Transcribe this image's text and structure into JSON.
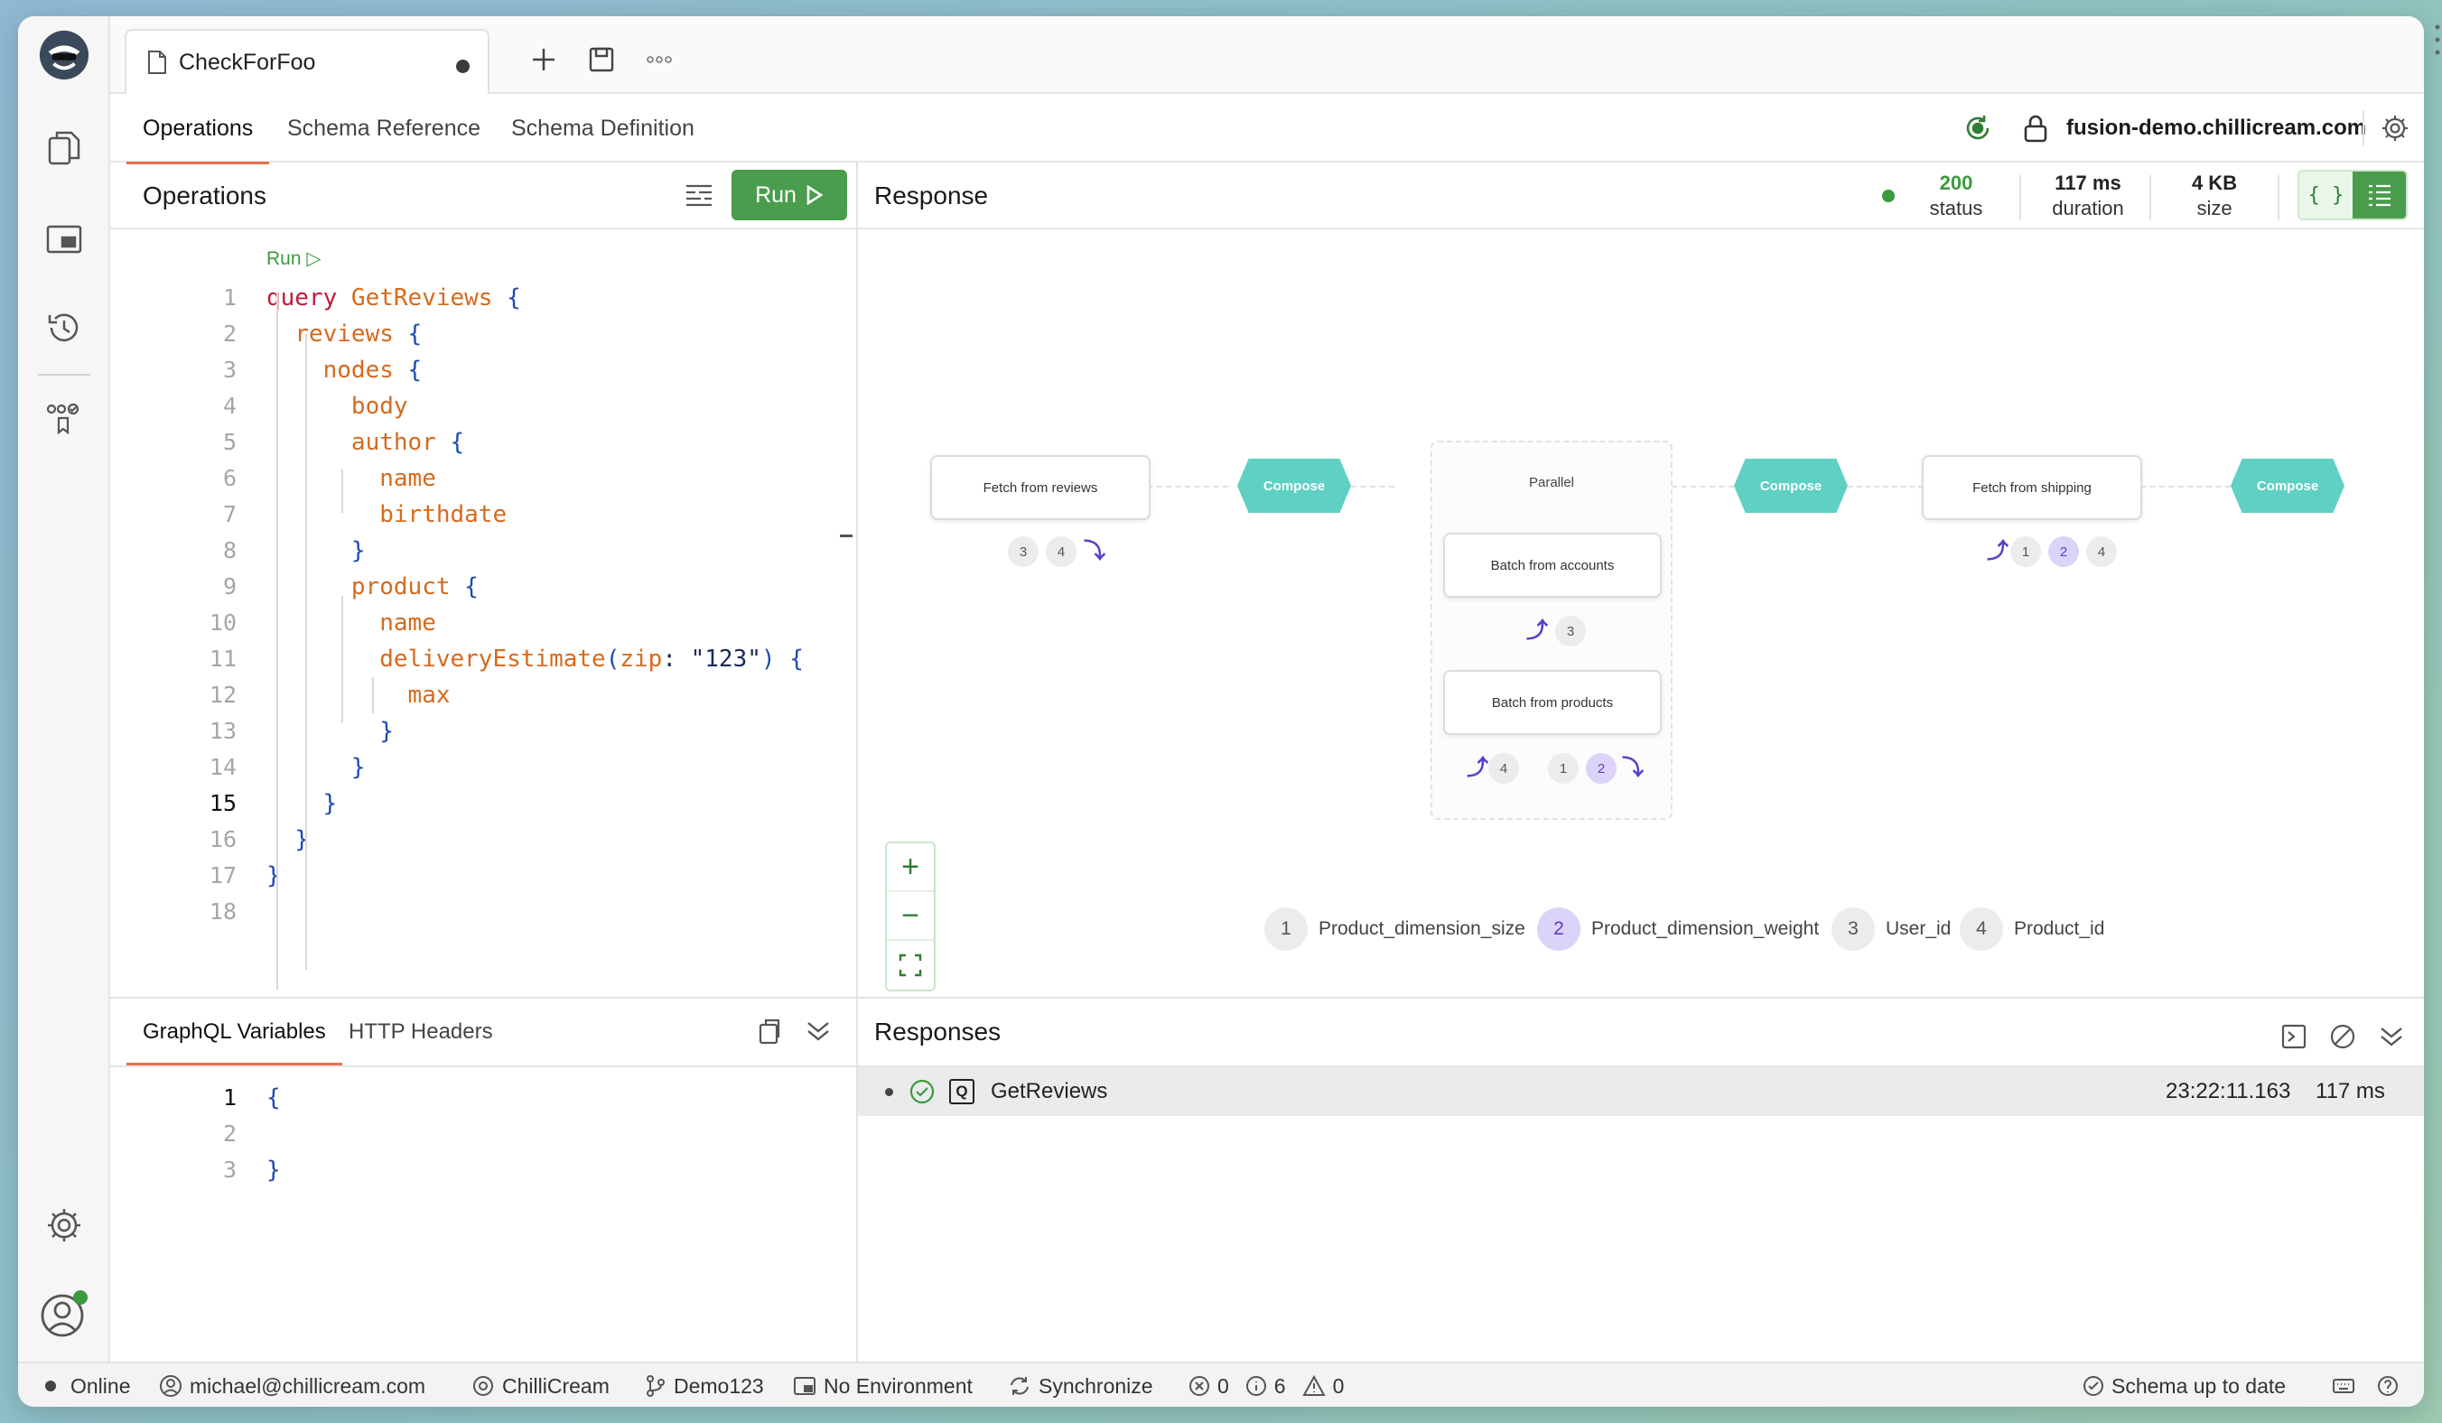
{
  "app": {
    "doc_tab_title": "CheckForFoo",
    "subtabs": [
      "Operations",
      "Schema Reference",
      "Schema Definition"
    ],
    "host": "fusion-demo.chillicream.com"
  },
  "operations": {
    "title": "Operations",
    "run_label": "Run",
    "codelens": "Run ▷",
    "lines": [
      {
        "n": "1",
        "tokens": [
          [
            "k-red",
            "query "
          ],
          [
            "k-orange",
            "GetReviews "
          ],
          [
            "k-blue",
            "{"
          ]
        ]
      },
      {
        "n": "2",
        "tokens": [
          [
            "",
            "  "
          ],
          [
            "k-orange",
            "reviews "
          ],
          [
            "k-blue",
            "{"
          ]
        ]
      },
      {
        "n": "3",
        "tokens": [
          [
            "",
            "    "
          ],
          [
            "k-orange",
            "nodes "
          ],
          [
            "k-blue",
            "{"
          ]
        ]
      },
      {
        "n": "4",
        "tokens": [
          [
            "",
            "      "
          ],
          [
            "k-orange",
            "body"
          ]
        ]
      },
      {
        "n": "5",
        "tokens": [
          [
            "",
            "      "
          ],
          [
            "k-orange",
            "author "
          ],
          [
            "k-blue",
            "{"
          ]
        ]
      },
      {
        "n": "6",
        "tokens": [
          [
            "",
            "        "
          ],
          [
            "k-orange",
            "name"
          ]
        ]
      },
      {
        "n": "7",
        "tokens": [
          [
            "",
            "        "
          ],
          [
            "k-orange",
            "birthdate"
          ]
        ]
      },
      {
        "n": "8",
        "tokens": [
          [
            "",
            "      "
          ],
          [
            "k-blue",
            "}"
          ]
        ]
      },
      {
        "n": "9",
        "tokens": [
          [
            "",
            "      "
          ],
          [
            "k-orange",
            "product "
          ],
          [
            "k-blue",
            "{"
          ]
        ]
      },
      {
        "n": "10",
        "tokens": [
          [
            "",
            "        "
          ],
          [
            "k-orange",
            "name"
          ]
        ]
      },
      {
        "n": "11",
        "tokens": [
          [
            "",
            "        "
          ],
          [
            "k-orange",
            "deliveryEstimate"
          ],
          [
            "k-blue",
            "("
          ],
          [
            "k-orange",
            "zip"
          ],
          [
            "k-dark",
            ": "
          ],
          [
            "k-dark",
            "\"123\""
          ],
          [
            "k-blue",
            ") {"
          ]
        ]
      },
      {
        "n": "12",
        "tokens": [
          [
            "",
            "          "
          ],
          [
            "k-orange",
            "max"
          ]
        ]
      },
      {
        "n": "13",
        "tokens": [
          [
            "",
            "        "
          ],
          [
            "k-blue",
            "}"
          ]
        ]
      },
      {
        "n": "14",
        "tokens": [
          [
            "",
            "      "
          ],
          [
            "k-blue",
            "}"
          ]
        ]
      },
      {
        "n": "15",
        "tokens": [
          [
            "",
            "    "
          ],
          [
            "k-blue",
            "}"
          ]
        ]
      },
      {
        "n": "16",
        "tokens": [
          [
            "",
            "  "
          ],
          [
            "k-blue",
            "}"
          ]
        ]
      },
      {
        "n": "17",
        "tokens": [
          [
            "k-blue",
            "}"
          ]
        ]
      },
      {
        "n": "18",
        "tokens": []
      }
    ],
    "current_line": "15"
  },
  "response": {
    "title": "Response",
    "status_value": "200",
    "status_label": "status",
    "duration_value": "117 ms",
    "duration_label": "duration",
    "size_value": "4 KB",
    "size_label": "size",
    "status_color": "#3a9a3d"
  },
  "plan": {
    "fetch_reviews": "Fetch from reviews",
    "compose1": "Compose",
    "parallel": "Parallel",
    "batch_accounts": "Batch from accounts",
    "batch_products": "Batch from products",
    "compose2": "Compose",
    "fetch_shipping": "Fetch from shipping",
    "compose3": "Compose",
    "badges": {
      "reviews": [
        "3",
        "4"
      ],
      "accounts": [
        "3"
      ],
      "products_a": [
        "4"
      ],
      "products_b": [
        "1",
        "2"
      ],
      "shipping": [
        "1",
        "2",
        "4"
      ]
    },
    "legend": [
      {
        "n": "1",
        "label": "Product_dimension_size"
      },
      {
        "n": "2",
        "label": "Product_dimension_weight"
      },
      {
        "n": "3",
        "label": "User_id"
      },
      {
        "n": "4",
        "label": "Product_id"
      }
    ]
  },
  "variables": {
    "tabs": [
      "GraphQL Variables",
      "HTTP Headers"
    ],
    "lines": [
      {
        "n": "1",
        "text": "{"
      },
      {
        "n": "2",
        "text": ""
      },
      {
        "n": "3",
        "text": "}"
      }
    ]
  },
  "responses": {
    "title": "Responses",
    "rows": [
      {
        "name": "GetReviews",
        "badge": "Q",
        "time": "23:22:11.163",
        "duration": "117 ms"
      }
    ]
  },
  "statusbar": {
    "online": "Online",
    "user": "michael@chillicream.com",
    "workspace": "ChilliCream",
    "branch": "Demo123",
    "environment": "No Environment",
    "sync": "Synchronize",
    "errors": "0",
    "infos": "6",
    "warnings": "0",
    "schema": "Schema up to date"
  }
}
